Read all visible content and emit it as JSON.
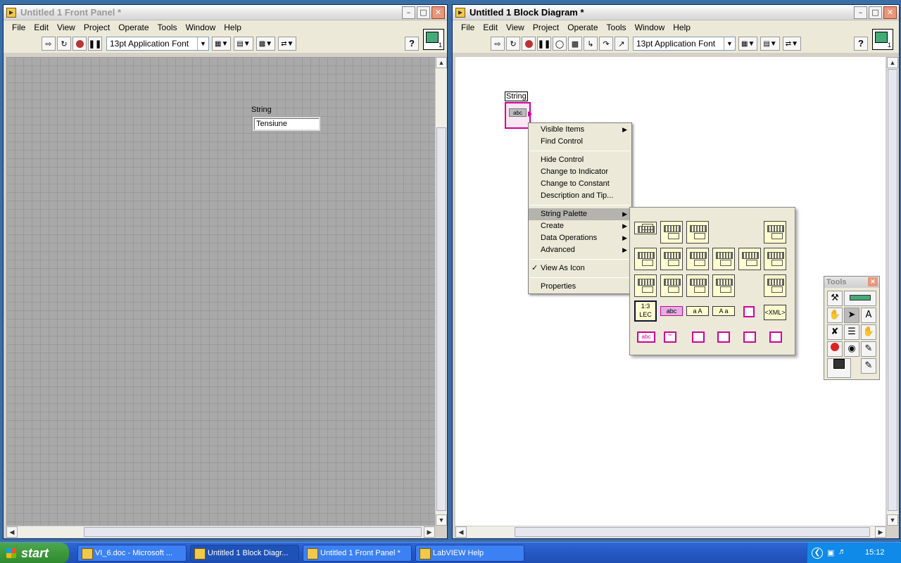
{
  "front_panel": {
    "title": "Untitled 1 Front Panel *",
    "menu": [
      "File",
      "Edit",
      "View",
      "Project",
      "Operate",
      "Tools",
      "Window",
      "Help"
    ],
    "font": "13pt Application Font",
    "control_label": "String",
    "control_value": "Tensiune",
    "icon_number": "1"
  },
  "block_diagram": {
    "title": "Untitled 1 Block Diagram *",
    "menu": [
      "File",
      "Edit",
      "View",
      "Project",
      "Operate",
      "Tools",
      "Window",
      "Help"
    ],
    "font": "13pt Application Font",
    "terminal_label": "String",
    "terminal_text": "abc",
    "icon_number": "1"
  },
  "context_menu": {
    "group1": [
      "Visible Items",
      "Find Control"
    ],
    "group2": [
      "Hide Control",
      "Change to Indicator",
      "Change to Constant",
      "Description and Tip..."
    ],
    "group3": [
      "String Palette",
      "Create",
      "Data Operations",
      "Advanced"
    ],
    "group4": [
      "View As Icon"
    ],
    "group5": [
      "Properties"
    ]
  },
  "string_palette": {
    "row4_labels": [
      "1:3 LEC",
      "abc",
      "a A",
      "A a",
      "",
      "<XML>"
    ],
    "row5_labels": [
      "abc",
      "\"\"",
      "",
      "",
      "",
      ""
    ]
  },
  "tools_palette": {
    "title": "Tools"
  },
  "taskbar": {
    "start": "start",
    "tasks": [
      "VI_6.doc - Microsoft ...",
      "Untitled 1 Block Diagr...",
      "Untitled 1 Front Panel *",
      "LabVIEW Help"
    ],
    "lang": "EN",
    "clock": "15:12"
  }
}
